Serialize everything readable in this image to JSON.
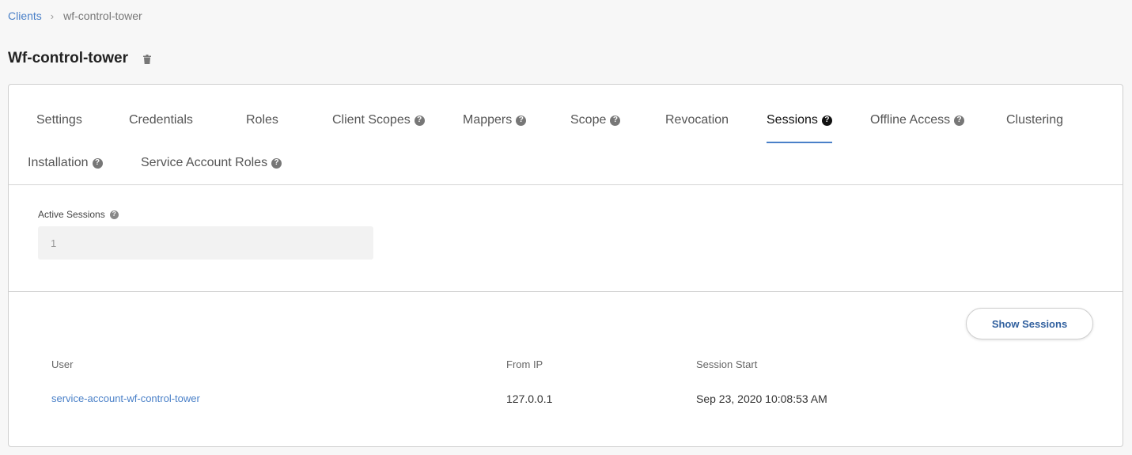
{
  "breadcrumb": {
    "parent": "Clients",
    "separator": "›",
    "current": "wf-control-tower"
  },
  "page": {
    "title": "Wf-control-tower",
    "delete_icon": "trash-icon"
  },
  "tabs": [
    {
      "label": "Settings",
      "help": false
    },
    {
      "label": "Credentials",
      "help": false
    },
    {
      "label": "Roles",
      "help": false
    },
    {
      "label": "Client Scopes",
      "help": true
    },
    {
      "label": "Mappers",
      "help": true
    },
    {
      "label": "Scope",
      "help": true
    },
    {
      "label": "Revocation",
      "help": false
    },
    {
      "label": "Sessions",
      "help": true,
      "active": true
    },
    {
      "label": "Offline Access",
      "help": true
    },
    {
      "label": "Clustering",
      "help": false
    },
    {
      "label": "Installation",
      "help": true
    },
    {
      "label": "Service Account Roles",
      "help": true
    }
  ],
  "help_glyph": "?",
  "active_sessions": {
    "label": "Active Sessions",
    "value": "1"
  },
  "sessions": {
    "button_label": "Show Sessions",
    "columns": [
      "User",
      "From IP",
      "Session Start"
    ],
    "rows": [
      [
        "service-account-wf-control-tower",
        "127.0.0.1",
        "Sep 23, 2020 10:08:53 AM"
      ]
    ]
  },
  "colors": {
    "accent": "#4a80c8",
    "button_text": "#2f5f9e",
    "background": "#f7f7f7"
  }
}
